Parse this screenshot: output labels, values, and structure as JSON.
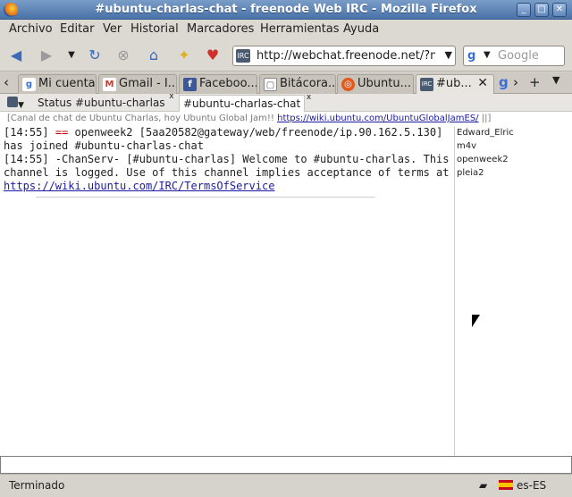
{
  "window": {
    "title": "#ubuntu-charlas-chat - freenode Web IRC - Mozilla Firefox",
    "buttons": [
      "_",
      "□",
      "✕"
    ]
  },
  "menu": [
    "Archivo",
    "Editar",
    "Ver",
    "Historial",
    "Marcadores",
    "Herramientas",
    "Ayuda"
  ],
  "nav": {
    "url": "http://webchat.freenode.net/?ni",
    "search_placeholder": "Google"
  },
  "tabs": [
    {
      "label": "Mi cuenta",
      "icon": "google-icon",
      "color": "#ffffff"
    },
    {
      "label": "Gmail - I...",
      "icon": "gmail-icon",
      "color": "#d93025"
    },
    {
      "label": "Faceboo...",
      "icon": "facebook-icon",
      "color": "#3b5998"
    },
    {
      "label": "Bitácora...",
      "icon": "blog-icon",
      "color": "#aaaaaa"
    },
    {
      "label": "Ubuntu...",
      "icon": "ubuntu-icon",
      "color": "#e05a1b"
    },
    {
      "label": "#ub...",
      "icon": "irc-icon",
      "color": "#4a5a70",
      "active": true
    }
  ],
  "irc": {
    "tabs": [
      "Status",
      "#ubuntu-charlas",
      "#ubuntu-charlas-chat"
    ],
    "topic_text": "[Canal de chat de Ubuntu Charlas, hoy Ubuntu Global Jam!!",
    "topic_link": "https://wiki.ubuntu.com/UbuntuGlobalJamES/",
    "topic_end": "||]",
    "log": {
      "l1_time": "[14:55]",
      "l1_mark": "==",
      "l1_text": "openweek2 [5aa20582@gateway/web/freenode/ip.90.162.5.130]",
      "l2": "has joined #ubuntu-charlas-chat",
      "l3": "[14:55] -ChanServ- [#ubuntu-charlas] Welcome to #ubuntu-charlas. This",
      "l4": "channel is logged. Use of this channel implies acceptance of terms at",
      "l5_link": "https://wiki.ubuntu.com/IRC/TermsOfService"
    },
    "nicks": [
      "Edward_Elric",
      "m4v",
      "openweek2",
      "pleia2"
    ]
  },
  "status": {
    "text": "Terminado",
    "lang": "es-ES"
  }
}
